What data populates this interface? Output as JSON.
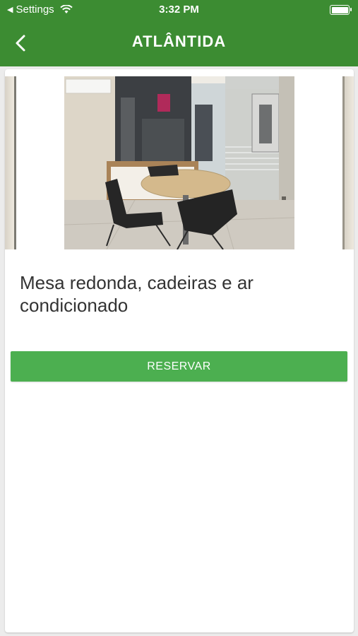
{
  "status_bar": {
    "back_app_label": "Settings",
    "time": "3:32 PM"
  },
  "header": {
    "title": "ATLÂNTIDA",
    "back_icon": "chevron-left-icon"
  },
  "room": {
    "description": "Mesa redonda, cadeiras e ar condicionado"
  },
  "actions": {
    "reserve_label": "RESERVAR"
  },
  "colors": {
    "header_green": "#3c8c32",
    "button_green": "#4caf50"
  }
}
